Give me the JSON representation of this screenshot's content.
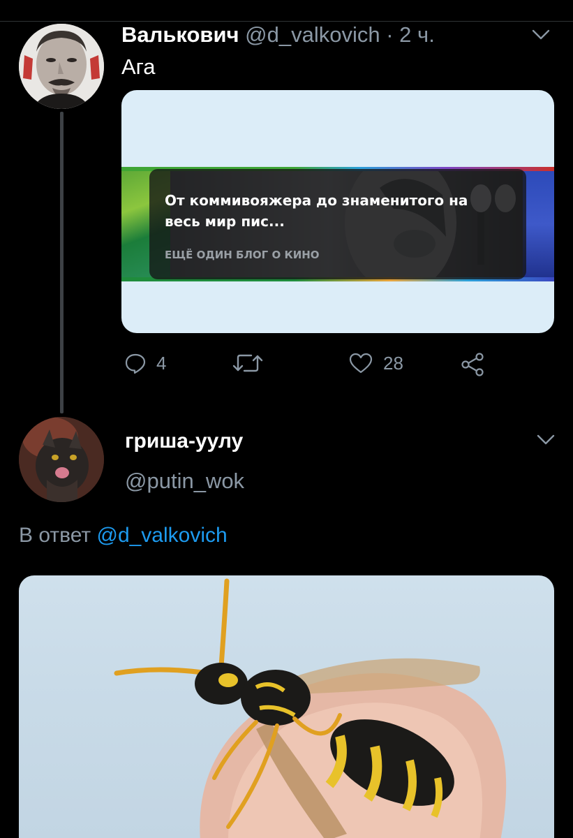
{
  "tweet1": {
    "author_name": "Валькович",
    "author_handle": "@d_valkovich",
    "time": "· 2 ч.",
    "text": "Ага",
    "card": {
      "title": "От коммивояжера до знаменитого на весь мир пис...",
      "source": "ЕЩЁ ОДИН БЛОГ О КИНО"
    },
    "actions": {
      "replies": "4",
      "retweets": "",
      "likes": "28"
    }
  },
  "tweet2": {
    "author_name": "гриша-уулу",
    "author_handle": "@putin_wok",
    "reply_prefix": "В ответ",
    "reply_to": "@d_valkovich"
  },
  "colors": {
    "background": "#000000",
    "secondary_text": "#8b98a5",
    "link": "#1d9bf0",
    "card_bg": "#dcedf8"
  }
}
